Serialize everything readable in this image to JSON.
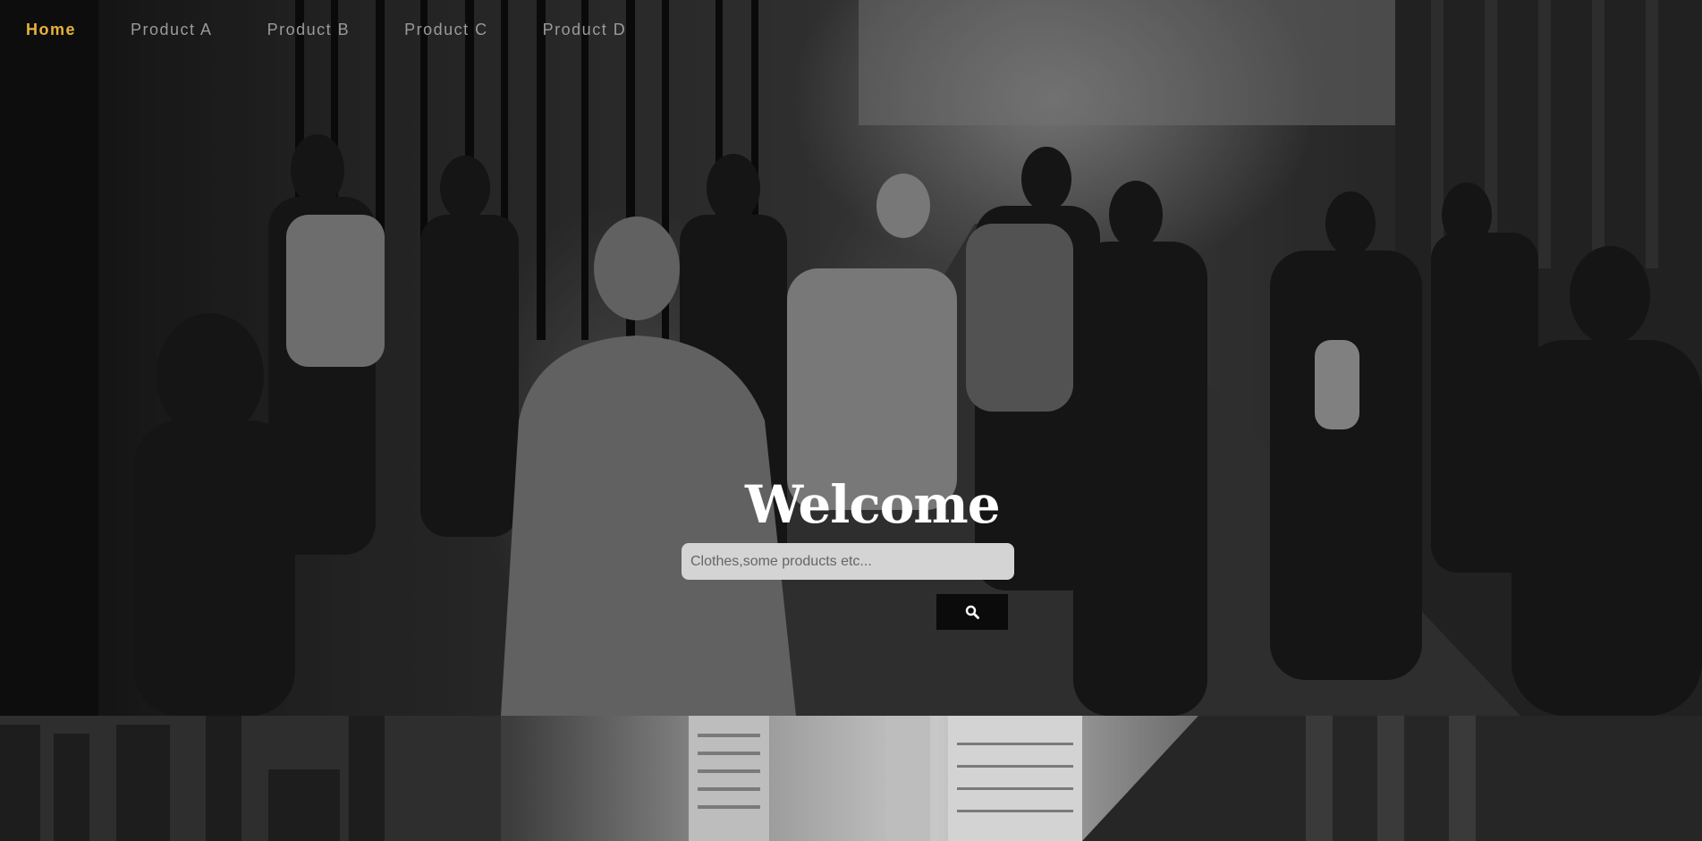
{
  "nav": {
    "items": [
      {
        "label": "Home",
        "active": true
      },
      {
        "label": "Product A",
        "active": false
      },
      {
        "label": "Product B",
        "active": false
      },
      {
        "label": "Product C",
        "active": false
      },
      {
        "label": "Product D",
        "active": false
      }
    ]
  },
  "hero": {
    "title": "Welcome",
    "search": {
      "placeholder": "Clothes,some products etc...",
      "value": "",
      "button_icon": "search-icon"
    }
  },
  "colors": {
    "nav_active": "#e8b33a",
    "nav_inactive": "#9a9a9a",
    "title": "#ffffff",
    "search_bg": "#d4d4d4",
    "search_button_bg": "#0b0b0b"
  }
}
